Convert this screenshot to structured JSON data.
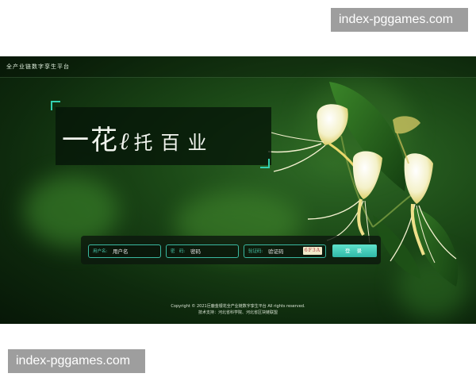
{
  "watermark": {
    "top": "index-pggames.com",
    "bottom": "index-pggames.com"
  },
  "header": {
    "title": "全产业链数字孪生平台"
  },
  "slogan": {
    "part1": "一花",
    "part2": "ℓ",
    "part3": "托百业"
  },
  "login": {
    "username_label": "用户名:",
    "username_value": "用户名",
    "password_label": "密　码:",
    "password_value": "密码",
    "captcha_label": "验证码:",
    "captcha_value": "验证码",
    "captcha_image_text": "6F3A",
    "submit_label": "登 录"
  },
  "footer": {
    "copyright": "Copyright © 2021巨鹿金银花全产业链数字孪生平台 All rights reserved.",
    "support": "技术支持：河北省科学院、河北省区块链联盟"
  },
  "colors": {
    "accent": "#33d1b0",
    "button": "#3fcdb9",
    "background": "#1c4a17"
  },
  "icons": [
    "honeysuckle-flower-illustration",
    "corner-bracket-icon"
  ]
}
